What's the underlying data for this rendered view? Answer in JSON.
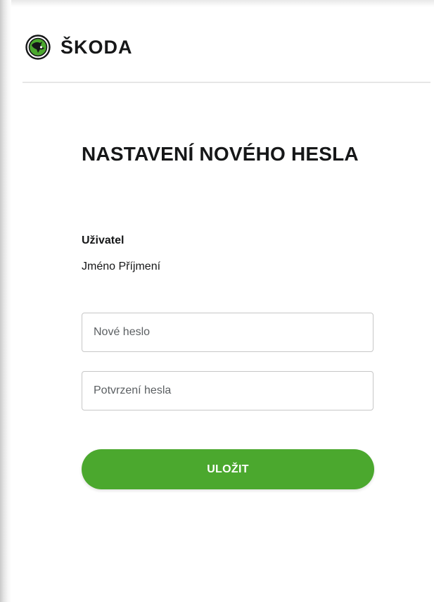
{
  "header": {
    "brand": "ŠKODA",
    "logo_icon": "skoda-winged-arrow-logo"
  },
  "main": {
    "title": "NASTAVENÍ NOVÉHO HESLA",
    "user_label": "Uživatel",
    "user_name": "Jméno Příjmení"
  },
  "form": {
    "new_password_placeholder": "Nové heslo",
    "confirm_password_placeholder": "Potvrzení hesla",
    "save_label": "ULOŽIT"
  },
  "colors": {
    "accent": "#4ba82e",
    "text": "#161718",
    "divider": "#e6e6e6",
    "field_border": "#c7c7c7"
  }
}
